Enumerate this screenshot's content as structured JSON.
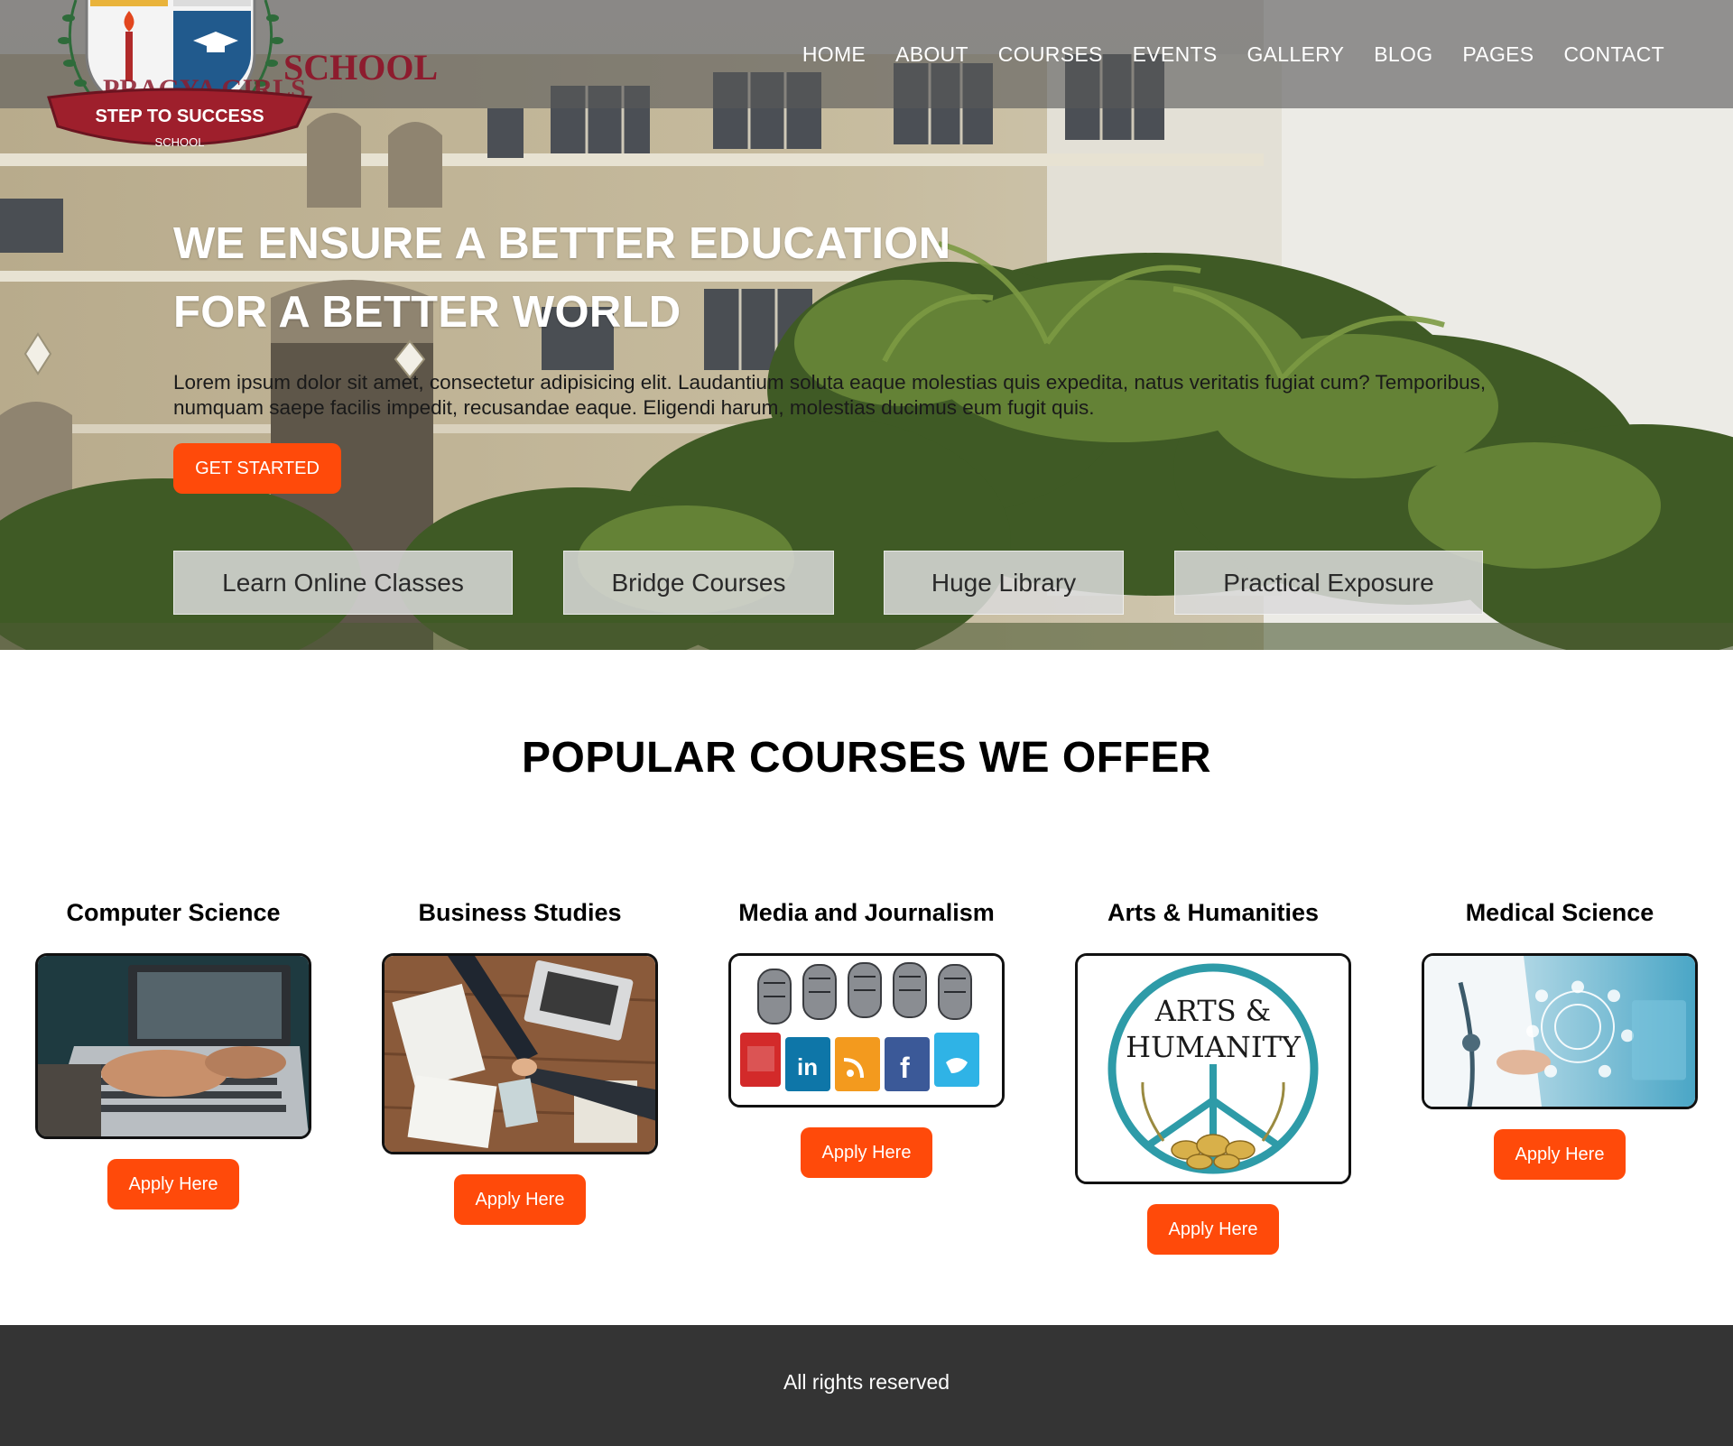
{
  "nav": {
    "items": [
      "HOME",
      "ABOUT",
      "COURSES",
      "EVENTS",
      "GALLERY",
      "BLOG",
      "PAGES",
      "CONTACT"
    ]
  },
  "logo": {
    "name_text": "PRAGYA GIRLS SCHOOL",
    "ribbon_text": "STEP TO SUCCESS",
    "sub_text": "SCHOOL"
  },
  "hero": {
    "title_line1": "WE ENSURE A BETTER EDUCATION",
    "title_line2": "FOR A BETTER WORLD",
    "text": "Lorem ipsum dolor sit amet, consectetur adipisicing elit. Laudantium soluta eaque molestias quis expedita, natus veritatis fugiat cum? Temporibus, numquam saepe facilis impedit, recusandae eaque. Eligendi harum, molestias ducimus eum fugit quis.",
    "cta_label": "GET STARTED",
    "features": [
      "Learn Online Classes",
      "Bridge Courses",
      "Huge Library",
      "Practical Exposure"
    ]
  },
  "courses": {
    "section_title": "POPULAR COURSES WE OFFER",
    "apply_label": "Apply Here",
    "items": [
      {
        "title": "Computer Science",
        "image_icon": "laptop-typing-photo"
      },
      {
        "title": "Business Studies",
        "image_icon": "business-handshake-photo"
      },
      {
        "title": "Media and Journalism",
        "image_icon": "microphones-social-media-photo"
      },
      {
        "title": "Arts & Humanities",
        "image_icon": "arts-humanity-peace-logo",
        "image_text_1": "ARTS &",
        "image_text_2": "HUMANITY"
      },
      {
        "title": "Medical Science",
        "image_icon": "doctor-digital-health-photo"
      }
    ]
  },
  "footer": {
    "text": "All rights reserved"
  },
  "colors": {
    "accent": "#ff4a0a",
    "footer_bg": "#343434",
    "navbar_bg": "rgba(88,88,88,0.62)"
  }
}
